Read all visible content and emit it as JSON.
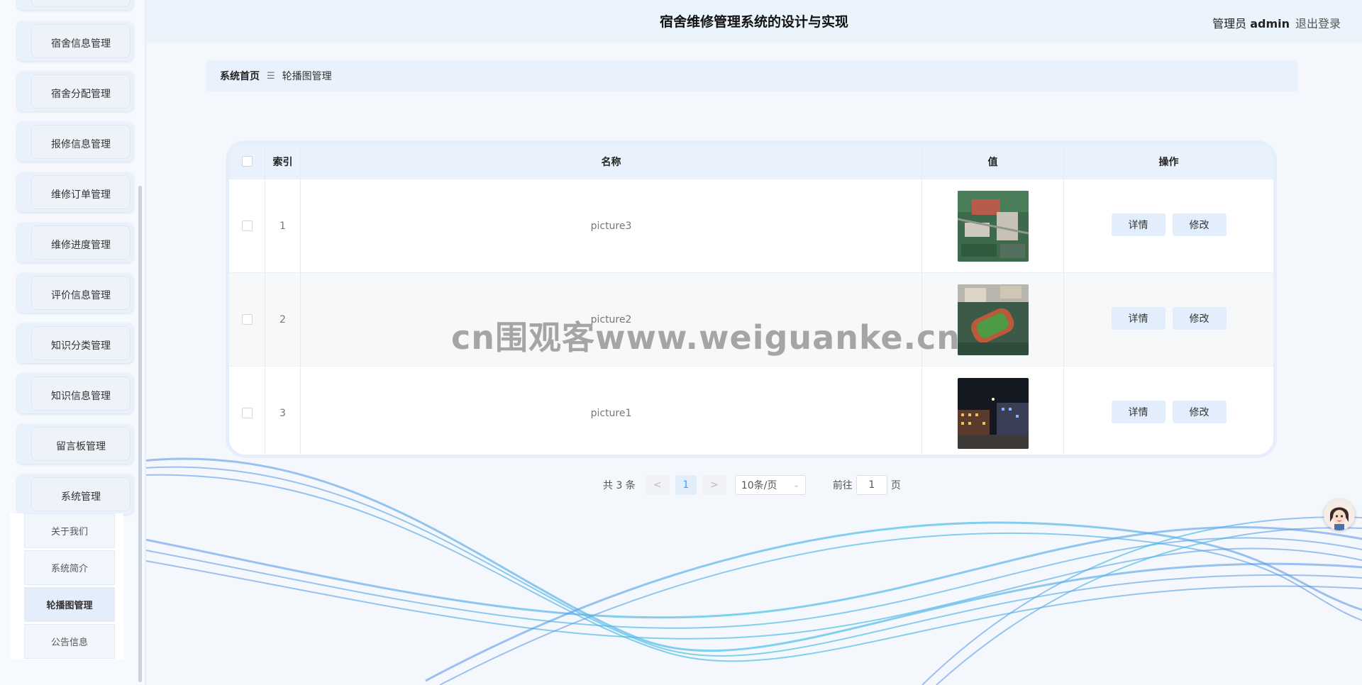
{
  "header": {
    "title": "宿舍维修管理系统的设计与实现",
    "user_role": "管理员",
    "user_name": "admin",
    "logout": "退出登录"
  },
  "sidebar": {
    "items": [
      {
        "label": ""
      },
      {
        "label": "宿舍信息管理"
      },
      {
        "label": "宿舍分配管理"
      },
      {
        "label": "报修信息管理"
      },
      {
        "label": "维修订单管理"
      },
      {
        "label": "维修进度管理"
      },
      {
        "label": "评价信息管理"
      },
      {
        "label": "知识分类管理"
      },
      {
        "label": "知识信息管理"
      },
      {
        "label": "留言板管理"
      },
      {
        "label": "系统管理"
      }
    ],
    "submenu": [
      {
        "label": "关于我们",
        "active": false
      },
      {
        "label": "系统简介",
        "active": false
      },
      {
        "label": "轮播图管理",
        "active": true
      },
      {
        "label": "公告信息",
        "active": false
      }
    ]
  },
  "breadcrumb": {
    "home": "系统首页",
    "separator": "☰",
    "current": "轮播图管理"
  },
  "table": {
    "columns": [
      "",
      "索引",
      "名称",
      "值",
      "操作"
    ],
    "rows": [
      {
        "index": "1",
        "name": "picture3",
        "image": "campus-aerial-1"
      },
      {
        "index": "2",
        "name": "picture2",
        "image": "campus-sports-field"
      },
      {
        "index": "3",
        "name": "picture1",
        "image": "campus-night"
      }
    ],
    "actions": {
      "detail": "详情",
      "edit": "修改"
    }
  },
  "pagination": {
    "total": "共 3 条",
    "prev": "<",
    "page": "1",
    "next": ">",
    "page_size": "10条/页",
    "goto_prefix": "前往",
    "goto_value": "1",
    "goto_suffix": "页"
  },
  "watermark": "cn围观客www.weiguanke.cn",
  "colors": {
    "accent": "#409eff",
    "header_bg": "#ebf3fd",
    "panel_bg": "#e8f1fc"
  }
}
